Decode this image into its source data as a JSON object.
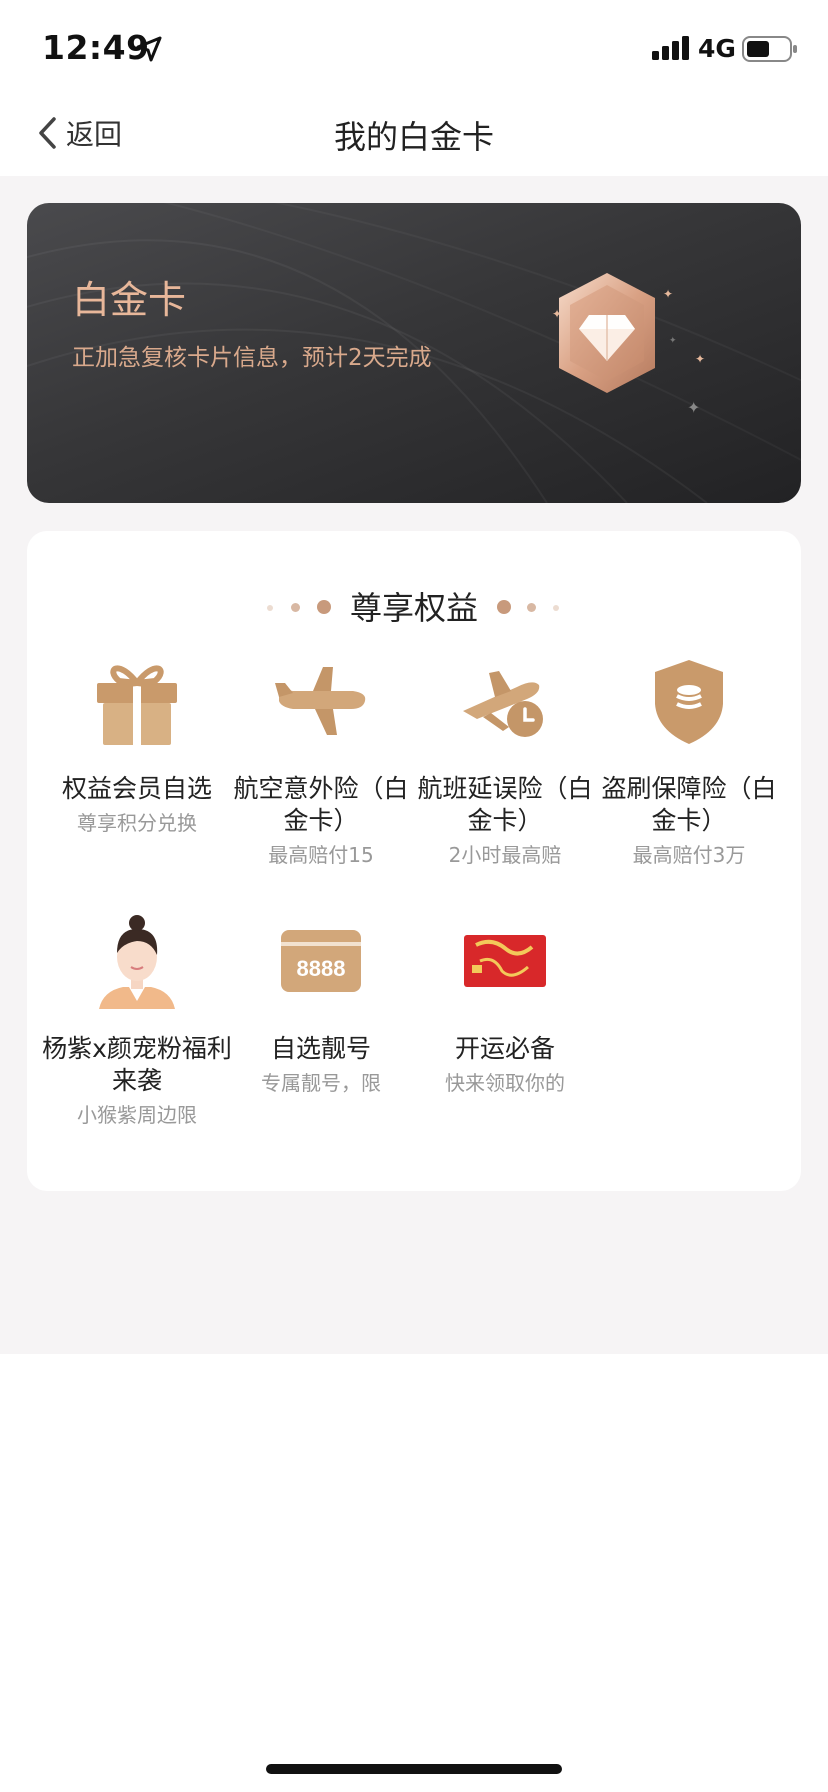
{
  "status_bar": {
    "time": "12:49",
    "network": "4G",
    "icons": [
      "location-arrow-icon",
      "signal-bars-icon",
      "battery-icon"
    ]
  },
  "nav": {
    "back_label": "返回",
    "title": "我的白金卡",
    "back_icon": "chevron-left-icon"
  },
  "card": {
    "name": "白金卡",
    "status": "正加急复核卡片信息，预计2天完成",
    "badge_icon": "diamond-badge-icon",
    "colors": {
      "accent": "#e8b79a",
      "background": "#2c2c2e"
    }
  },
  "benefits": {
    "title": "尊享权益",
    "items": [
      {
        "title": "权益会员自选",
        "subtitle": "尊享积分兑换",
        "icon": "gift-icon"
      },
      {
        "title": "航空意外险（白金卡）",
        "subtitle": "最高赔付15",
        "icon": "airplane-icon"
      },
      {
        "title": "航班延误险（白金卡）",
        "subtitle": "2小时最高赔",
        "icon": "plane-delay-icon"
      },
      {
        "title": "盗刷保障险（白金卡）",
        "subtitle": "最高赔付3万",
        "icon": "shield-coins-icon"
      },
      {
        "title": "杨紫x颜宠粉福利来袭",
        "subtitle": "小猴紫周边限",
        "icon": "avatar-photo-icon"
      },
      {
        "title": "自选靓号",
        "subtitle": "专属靓号，限",
        "icon": "number-card-icon",
        "badge_text": "8888"
      },
      {
        "title": "开运必备",
        "subtitle": "快来领取你的",
        "icon": "red-card-icon"
      }
    ]
  },
  "colors": {
    "gold": "#c89a6e",
    "page_bg": "#f6f4f5"
  }
}
